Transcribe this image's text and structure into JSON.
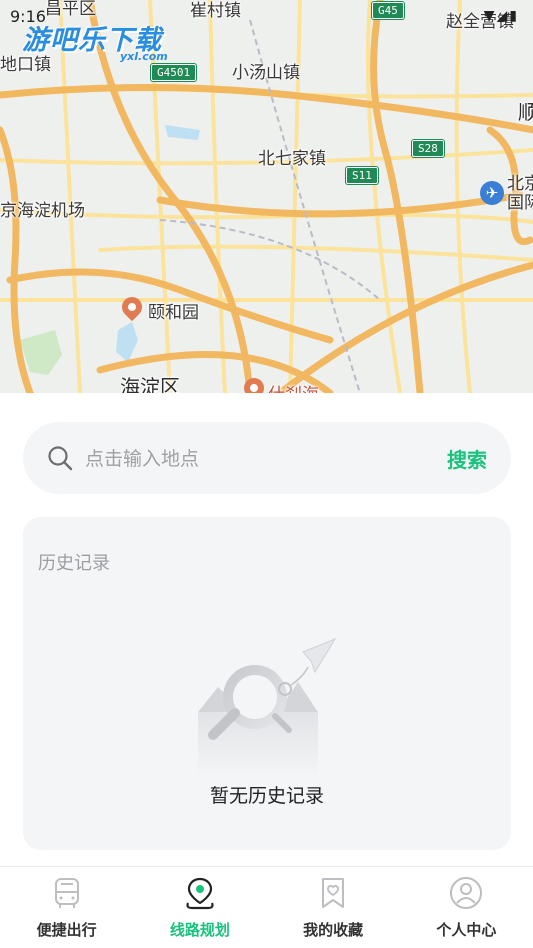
{
  "status_bar": {
    "time": "9:16",
    "icons": [
      "wifi-icon",
      "signal-icon",
      "battery-icon"
    ]
  },
  "watermark": {
    "title": "游吧乐下载",
    "subtitle": "yxl.com"
  },
  "map": {
    "labels": {
      "changping": "昌平区",
      "cuicun": "崔村镇",
      "xiaotangshan": "小汤山镇",
      "beiqijia": "北七家镇",
      "beidiaoqiao": "赵全营镇",
      "shahe": "地口镇",
      "haidian_airport": "京海淀机场",
      "yiheyuan": "颐和园",
      "haidian": "海淀区",
      "shichahai": "什刹海",
      "capital_airport": "北京\n国际",
      "shun": "顺"
    },
    "shields": {
      "g45": "G45",
      "g4501": "G4501",
      "s28": "S28",
      "s11": "S11"
    }
  },
  "search": {
    "placeholder": "点击输入地点",
    "value": "",
    "button_label": "搜索"
  },
  "history": {
    "title": "历史记录",
    "empty_text": "暂无历史记录"
  },
  "nav": {
    "items": [
      {
        "label": "便捷出行",
        "icon": "bus-icon",
        "active": false
      },
      {
        "label": "线路规划",
        "icon": "map-route-icon",
        "active": true
      },
      {
        "label": "我的收藏",
        "icon": "favorite-icon",
        "active": false
      },
      {
        "label": "个人中心",
        "icon": "user-icon",
        "active": false
      }
    ]
  },
  "colors": {
    "accent": "#19c27d",
    "panel_bg": "#f4f5f7",
    "road_major": "#f5c56a",
    "road_minor": "#fbe39c"
  }
}
